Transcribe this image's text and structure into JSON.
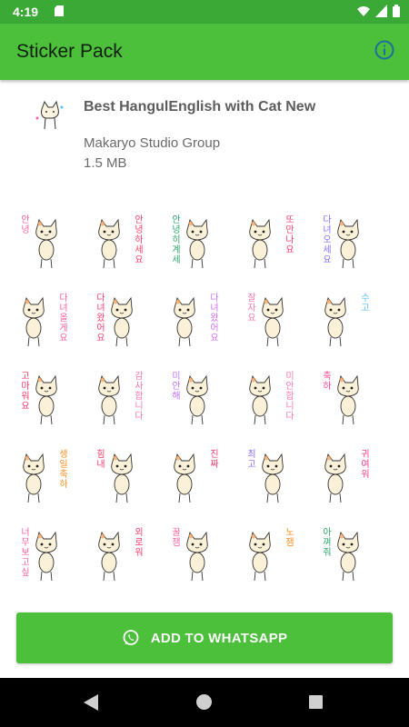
{
  "status_bar": {
    "time": "4:19"
  },
  "app_bar": {
    "title": "Sticker Pack",
    "info_icon": "info-icon"
  },
  "pack": {
    "name": "Best HangulEnglish with Cat New",
    "publisher": "Makaryo Studio Group",
    "size": "1.5 MB"
  },
  "stickers": [
    {
      "text": "안녕",
      "color": "#ff5fa0"
    },
    {
      "text": "안녕하세요",
      "color": "#ff3b6b"
    },
    {
      "text": "안녕히계세요",
      "color": "#2aa56a"
    },
    {
      "text": "또만나요",
      "color": "#ff3b6b"
    },
    {
      "text": "다녀오세요",
      "color": "#8a6bff"
    },
    {
      "text": "다녀올게요",
      "color": "#ff5fa0"
    },
    {
      "text": "다녀왔어요",
      "color": "#ff3b6b"
    },
    {
      "text": "다녀왔어요",
      "color": "#d070ff"
    },
    {
      "text": "잘자요",
      "color": "#ff78b0"
    },
    {
      "text": "수고",
      "color": "#56c0ff"
    },
    {
      "text": "고마워요",
      "color": "#ff3b6b"
    },
    {
      "text": "감사합니다",
      "color": "#ff78b0"
    },
    {
      "text": "미안해",
      "color": "#c070ff"
    },
    {
      "text": "미안합니다",
      "color": "#ff78b0"
    },
    {
      "text": "축하",
      "color": "#ff3b8f"
    },
    {
      "text": "생일축하",
      "color": "#ff8c1a"
    },
    {
      "text": "힘내",
      "color": "#ff3b6b"
    },
    {
      "text": "진짜",
      "color": "#ff3b6b"
    },
    {
      "text": "최고",
      "color": "#8a6bff"
    },
    {
      "text": "귀여워",
      "color": "#ff3b8f"
    },
    {
      "text": "너무보고싶다",
      "color": "#ff5fa0"
    },
    {
      "text": "외로워",
      "color": "#ff3b6b"
    },
    {
      "text": "꿀잼",
      "color": "#ff5fa0"
    },
    {
      "text": "노잼",
      "color": "#ff8c1a"
    },
    {
      "text": "아껴줘",
      "color": "#2aa56a"
    }
  ],
  "add_button": {
    "label": "ADD TO WHATSAPP",
    "icon": "whatsapp-icon"
  },
  "nav": {
    "back": "back-icon",
    "home": "home-icon",
    "recents": "recents-icon"
  }
}
